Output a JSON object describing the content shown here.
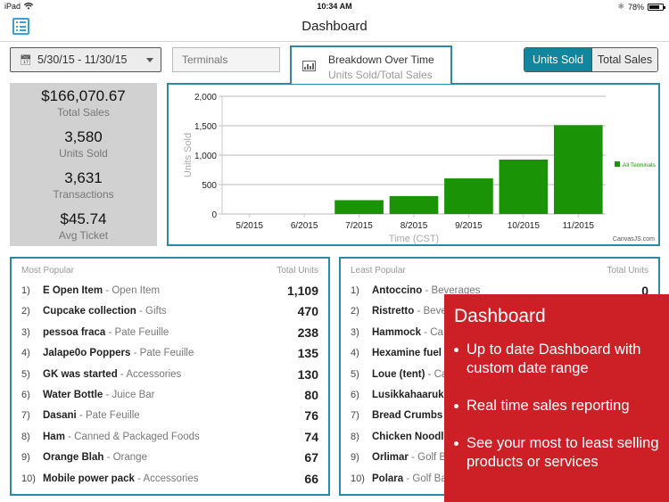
{
  "status_bar": {
    "device": "iPad",
    "time": "10:34 AM",
    "battery": "78%",
    "battery_level": 0.78
  },
  "nav": {
    "title": "Dashboard",
    "menu_icon": "list-menu-icon"
  },
  "filters": {
    "date_range": "5/30/15 - 11/30/15",
    "terminals_placeholder": "Terminals"
  },
  "chart_tab": {
    "title": "Breakdown Over Time",
    "subtitle": "Units Sold/Total Sales"
  },
  "toggle": {
    "options": [
      "Units Sold",
      "Total Sales"
    ],
    "selected": "Units Sold"
  },
  "summary": [
    {
      "value": "$166,070.67",
      "label": "Total Sales"
    },
    {
      "value": "3,580",
      "label": "Units Sold"
    },
    {
      "value": "3,631",
      "label": "Transactions"
    },
    {
      "value": "$45.74",
      "label": "Avg Ticket"
    }
  ],
  "chart_data": {
    "type": "bar",
    "title": "",
    "xlabel": "Time (CST)",
    "ylabel": "Units Sold",
    "categories": [
      "5/2015",
      "6/2015",
      "7/2015",
      "8/2015",
      "9/2015",
      "10/2015",
      "11/2015"
    ],
    "series": [
      {
        "name": "All Terminals",
        "color": "#1a9306",
        "values": [
          0,
          0,
          235,
          305,
          605,
          925,
          1510
        ]
      }
    ],
    "yticks": [
      0,
      500,
      1000,
      1500,
      2000
    ],
    "ytick_labels": [
      "0",
      "500",
      "1,000",
      "1,500",
      "2,000"
    ],
    "ylim": [
      0,
      2000
    ],
    "grid": true,
    "legend": "right",
    "credit": "CanvasJS.com"
  },
  "most_popular": {
    "header": "Most Popular",
    "units_header": "Total Units",
    "items": [
      {
        "rank": "1)",
        "name": "E Open Item",
        "category": "Open Item",
        "units": "1,109"
      },
      {
        "rank": "2)",
        "name": "Cupcake collection",
        "category": "Gifts",
        "units": "470"
      },
      {
        "rank": "3)",
        "name": "pessoa fraca",
        "category": "Pate Feuille",
        "units": "238"
      },
      {
        "rank": "4)",
        "name": "Jalape0o Poppers",
        "category": "Pate Feuille",
        "units": "135"
      },
      {
        "rank": "5)",
        "name": "GK was started",
        "category": "Accessories",
        "units": "130"
      },
      {
        "rank": "6)",
        "name": "Water Bottle",
        "category": "Juice Bar",
        "units": "80"
      },
      {
        "rank": "7)",
        "name": "Dasani",
        "category": "Pate Feuille",
        "units": "76"
      },
      {
        "rank": "8)",
        "name": "Ham",
        "category": "Canned & Packaged Foods",
        "units": "74"
      },
      {
        "rank": "9)",
        "name": "Orange Blah",
        "category": "Orange",
        "units": "67"
      },
      {
        "rank": "10)",
        "name": "Mobile power pack",
        "category": "Accessories",
        "units": "66"
      }
    ]
  },
  "least_popular": {
    "header": "Least Popular",
    "units_header": "Total Units",
    "items": [
      {
        "rank": "1)",
        "name": "Antoccino",
        "category": "Beverages",
        "units": "0"
      },
      {
        "rank": "2)",
        "name": "Ristretto",
        "category": "Beve",
        "units": ""
      },
      {
        "rank": "3)",
        "name": "Hammock",
        "category": "Ca",
        "units": ""
      },
      {
        "rank": "4)",
        "name": "Hexamine fuel",
        "category": "",
        "units": ""
      },
      {
        "rank": "5)",
        "name": "Loue (tent)",
        "category": "Ca",
        "units": ""
      },
      {
        "rank": "6)",
        "name": "Lusikkahaaruk",
        "category": "",
        "units": ""
      },
      {
        "rank": "7)",
        "name": "Bread Crumbs",
        "category": "",
        "units": ""
      },
      {
        "rank": "8)",
        "name": "Chicken Noodl",
        "category": "",
        "units": ""
      },
      {
        "rank": "9)",
        "name": "Orlimar",
        "category": "Golf B",
        "units": ""
      },
      {
        "rank": "10)",
        "name": "Polara",
        "category": "Golf Ba",
        "units": ""
      }
    ]
  },
  "promo": {
    "title": "Dashboard",
    "bullets": [
      "Up to date Dashboard with custom date range",
      "Real time sales reporting",
      "See your most to least selling products or services"
    ],
    "color": "#cc1f26"
  }
}
